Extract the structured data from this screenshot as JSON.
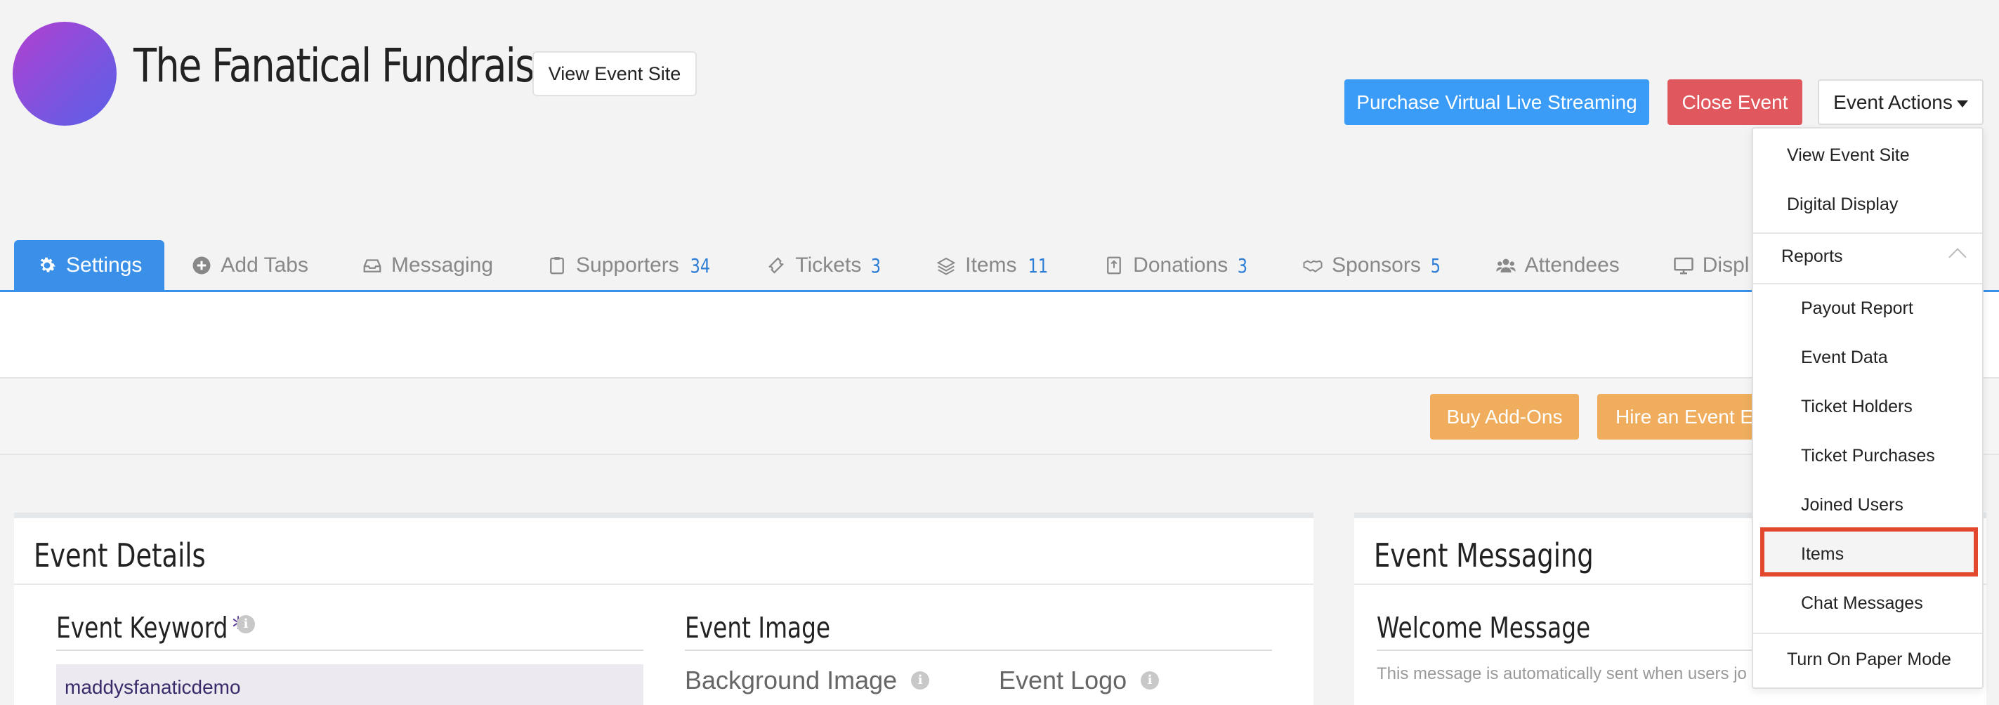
{
  "header": {
    "event_title": "The Fanatical Fundraiser",
    "view_site_label": "View Event Site",
    "purchase_streaming_label": "Purchase Virtual Live Streaming",
    "close_event_label": "Close Event",
    "event_actions_label": "Event Actions"
  },
  "tabs": [
    {
      "label": "Settings",
      "count": "",
      "icon": "gear-icon"
    },
    {
      "label": "Add Tabs",
      "count": "",
      "icon": "plus-circle-icon"
    },
    {
      "label": "Messaging",
      "count": "",
      "icon": "inbox-icon"
    },
    {
      "label": "Supporters",
      "count": "34",
      "icon": "clipboard-icon"
    },
    {
      "label": "Tickets",
      "count": "3",
      "icon": "ticket-icon"
    },
    {
      "label": "Items",
      "count": "11",
      "icon": "layers-icon"
    },
    {
      "label": "Donations",
      "count": "3",
      "icon": "donation-icon"
    },
    {
      "label": "Sponsors",
      "count": "5",
      "icon": "handshake-icon"
    },
    {
      "label": "Attendees",
      "count": "",
      "icon": "users-icon"
    },
    {
      "label": "Displ",
      "count": "",
      "icon": "monitor-icon"
    }
  ],
  "addons": {
    "buy_addons_label": "Buy Add-Ons",
    "hire_label": "Hire an Event Ex"
  },
  "event_details": {
    "title": "Event Details",
    "keyword_label": "Event Keyword",
    "required_mark": "*",
    "keyword_value": "maddysfanaticdemo",
    "image_heading": "Event Image",
    "background_image_label": "Background Image",
    "event_logo_label": "Event Logo"
  },
  "event_messaging": {
    "title": "Event Messaging",
    "welcome_heading": "Welcome Message",
    "welcome_hint": "This message is automatically sent when users jo"
  },
  "dropdown": {
    "view_event_site": "View Event Site",
    "digital_display": "Digital Display",
    "reports_label": "Reports",
    "reports": [
      "Payout Report",
      "Event Data",
      "Ticket Holders",
      "Ticket Purchases",
      "Joined Users",
      "Items",
      "Chat Messages"
    ],
    "paper_mode": "Turn On Paper Mode"
  },
  "colors": {
    "primary_blue": "#3a90e8",
    "danger_red": "#e0575e",
    "addon_orange": "#efad5d",
    "highlight_red": "#e2482e"
  }
}
